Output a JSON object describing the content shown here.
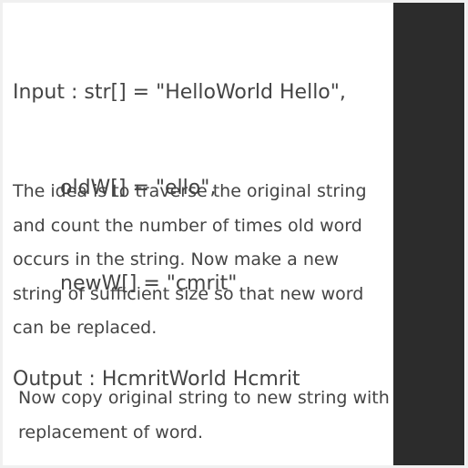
{
  "example": {
    "input_line": "Input : str[] = \"HelloWorld Hello\",",
    "oldw_line": "oldW[] = \"ello\",",
    "neww_line": "newW[] = \"cmrit\"",
    "output_line": "Output : HcmritWorld Hcmrit"
  },
  "explanation": {
    "paragraph_1": "The idea is to traverse the original string and count the number of times old word occurs in the string. Now make a new string of sufficient size so that new word can be replaced.",
    "paragraph_2": "Now copy original string to new string with replacement of word."
  },
  "colors": {
    "text": "#444444",
    "side_panel": "#2c2c2c",
    "background": "#ffffff"
  }
}
